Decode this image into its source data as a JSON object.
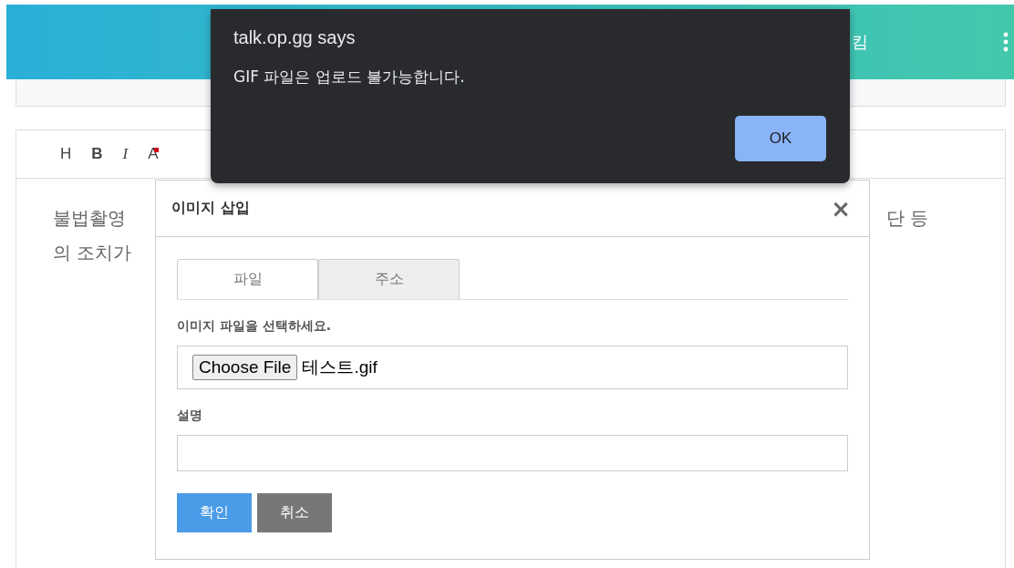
{
  "header": {
    "text": "킴"
  },
  "editor": {
    "toolbar": [
      {
        "kind": "heading",
        "label": "H"
      },
      {
        "kind": "bold",
        "label": "B"
      },
      {
        "kind": "italic",
        "label": "I"
      },
      {
        "kind": "color",
        "label": "A"
      }
    ],
    "lines_left": [
      "불법촬영",
      "의 조치가"
    ],
    "lines_right": [
      "단 등"
    ]
  },
  "image_dialog": {
    "title": "이미지 삽입",
    "close": "×",
    "tabs": [
      {
        "label": "파일",
        "selected": true
      },
      {
        "label": "주소",
        "selected": false
      }
    ],
    "file_label": "이미지 파일을 선택하세요.",
    "file_button": "Choose File",
    "file_name": "테스트.gif",
    "description_label": "설명",
    "buttons": [
      {
        "label": "확인",
        "kind": "primary"
      },
      {
        "label": "취소",
        "kind": "secondary"
      }
    ]
  },
  "alert": {
    "title": "talk.op.gg says",
    "message": "GIF 파일은 업로드 불가능합니다.",
    "button": "OK"
  }
}
